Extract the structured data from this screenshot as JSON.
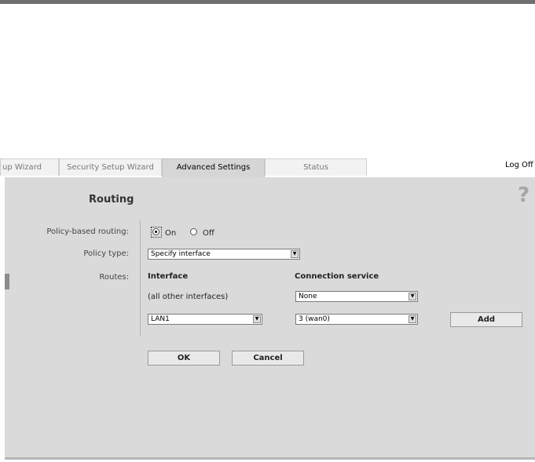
{
  "tabs": [
    "up Wizard",
    "Security Setup Wizard",
    "Advanced Settings",
    "Status"
  ],
  "logoff": "Log Off",
  "page": {
    "title": "Routing",
    "help": "?"
  },
  "form": {
    "policy_label": "Policy-based routing:",
    "on_label": "On",
    "off_label": "Off",
    "policy_type_label": "Policy type:",
    "policy_type_value": "Specify interface",
    "routes_label": "Routes:",
    "interface_header": "Interface",
    "connection_header": "Connection service",
    "other_interfaces": "(all other interfaces)",
    "other_connection": "None",
    "interface_select": "LAN1",
    "connection_select": "3 (wan0)",
    "add_label": "Add",
    "ok_label": "OK",
    "cancel_label": "Cancel"
  }
}
